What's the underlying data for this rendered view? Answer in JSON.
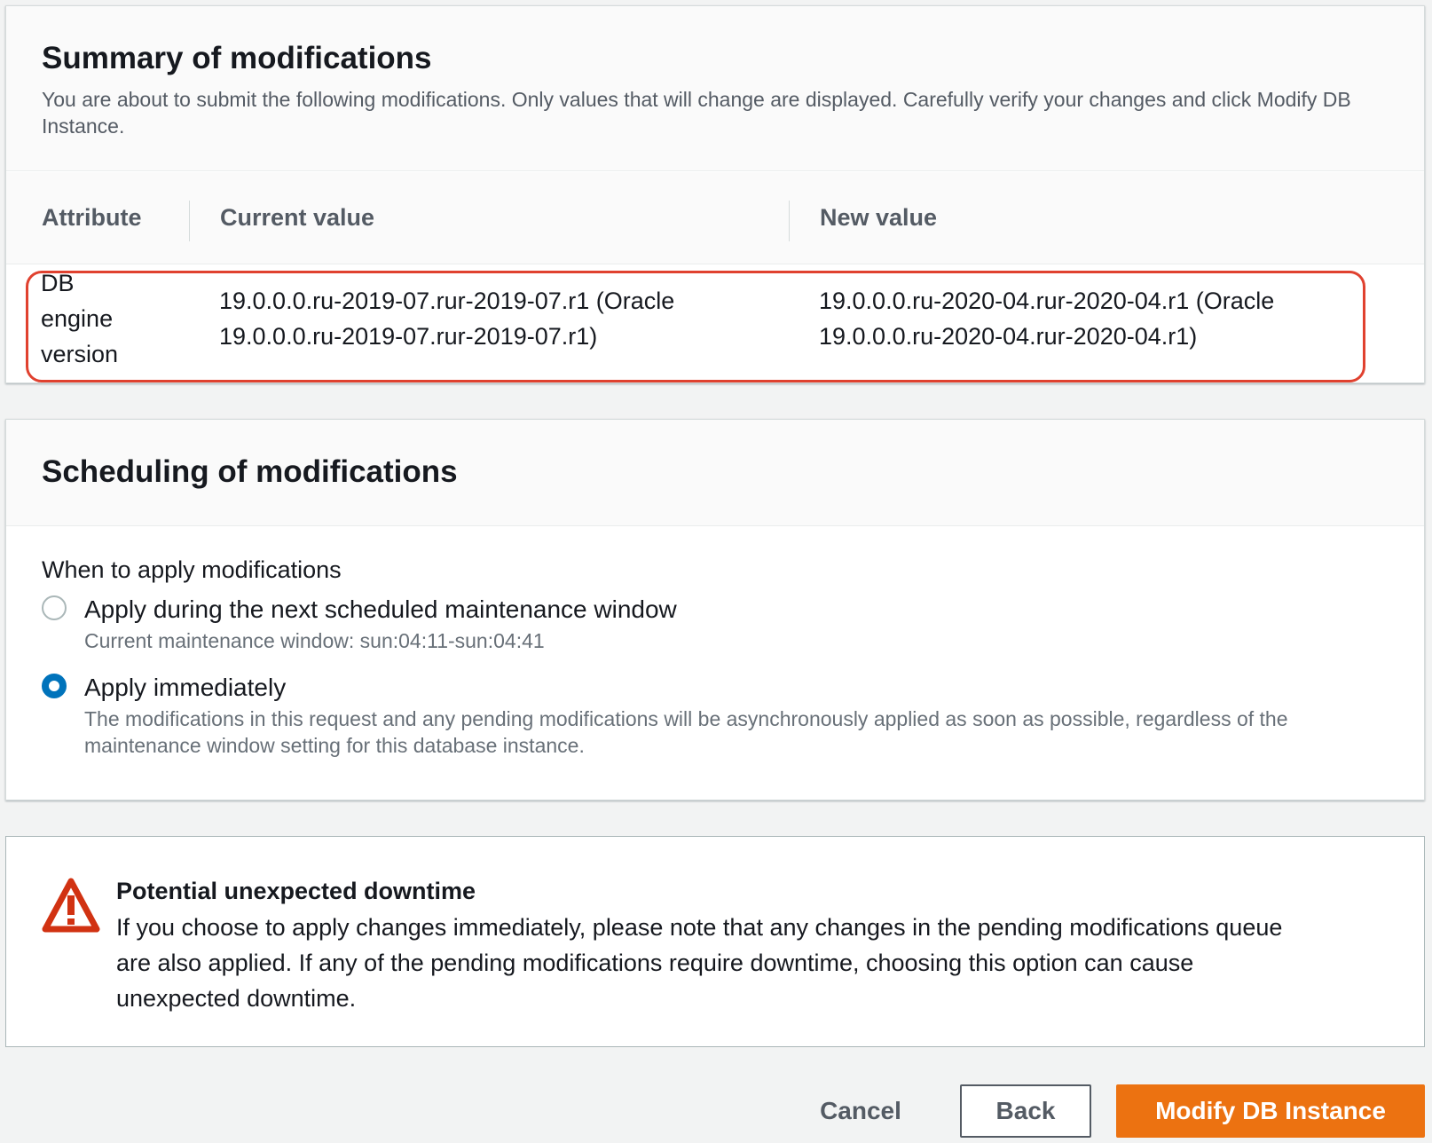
{
  "summary": {
    "title": "Summary of modifications",
    "description": "You are about to submit the following modifications. Only values that will change are displayed. Carefully verify your changes and click Modify DB Instance.",
    "columns": [
      "Attribute",
      "Current value",
      "New value"
    ],
    "rows": [
      {
        "attribute_lines": [
          "DB",
          "engine",
          "version"
        ],
        "current_lines": [
          "19.0.0.0.ru-2019-07.rur-2019-07.r1 (Oracle",
          "19.0.0.0.ru-2019-07.rur-2019-07.r1)"
        ],
        "new_lines": [
          "19.0.0.0.ru-2020-04.rur-2020-04.r1 (Oracle",
          "19.0.0.0.ru-2020-04.rur-2020-04.r1)"
        ]
      }
    ],
    "highlight_color": "#e0412f"
  },
  "scheduling": {
    "title": "Scheduling of modifications",
    "label": "When to apply modifications",
    "options": [
      {
        "label": "Apply during the next scheduled maintenance window",
        "description": "Current maintenance window: sun:04:11-sun:04:41",
        "selected": false
      },
      {
        "label": "Apply immediately",
        "description": "The modifications in this request and any pending modifications will be asynchronously applied as soon as possible, regardless of the maintenance window setting for this database instance.",
        "selected": true
      }
    ]
  },
  "warning": {
    "icon": "warning-triangle-icon",
    "title": "Potential unexpected downtime",
    "text_lines": [
      "If you choose to apply changes immediately, please note that any changes in the pending modifications queue",
      "are also applied. If any of the pending modifications require downtime, choosing this option can cause",
      "unexpected downtime."
    ],
    "color": "#d13212"
  },
  "footer": {
    "cancel_label": "Cancel",
    "back_label": "Back",
    "modify_label": "Modify DB Instance",
    "primary_color": "#ec7211"
  }
}
